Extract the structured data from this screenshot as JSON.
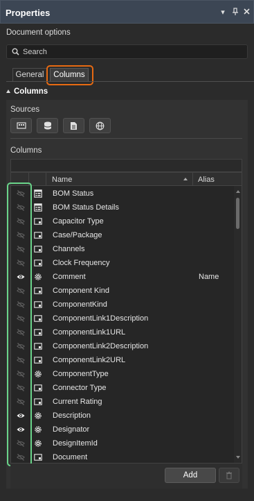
{
  "panel": {
    "title": "Properties",
    "subtitle": "Document options"
  },
  "search": {
    "placeholder": "Search"
  },
  "tabs": [
    {
      "label": "General",
      "active": false
    },
    {
      "label": "Columns",
      "active": true
    }
  ],
  "section": {
    "title": "Columns"
  },
  "sources": {
    "label": "Sources",
    "buttons": [
      "component-icon",
      "database-icon",
      "document-icon",
      "globe-icon"
    ]
  },
  "columns": {
    "label": "Columns",
    "headers": {
      "name": "Name",
      "alias": "Alias"
    },
    "rows": [
      {
        "name": "BOM Status",
        "alias": "",
        "visible": false,
        "type": "bom-icon"
      },
      {
        "name": "BOM Status Details",
        "alias": "",
        "visible": false,
        "type": "bom-icon"
      },
      {
        "name": "Capacitor Type",
        "alias": "",
        "visible": false,
        "type": "parameter-icon"
      },
      {
        "name": "Case/Package",
        "alias": "",
        "visible": false,
        "type": "parameter-icon"
      },
      {
        "name": "Channels",
        "alias": "",
        "visible": false,
        "type": "parameter-icon"
      },
      {
        "name": "Clock Frequency",
        "alias": "",
        "visible": false,
        "type": "parameter-icon"
      },
      {
        "name": "Comment",
        "alias": "Name",
        "visible": true,
        "type": "system-icon"
      },
      {
        "name": "Component Kind",
        "alias": "",
        "visible": false,
        "type": "parameter-icon"
      },
      {
        "name": "ComponentKind",
        "alias": "",
        "visible": false,
        "type": "parameter-icon"
      },
      {
        "name": "ComponentLink1Description",
        "alias": "",
        "visible": false,
        "type": "parameter-icon"
      },
      {
        "name": "ComponentLink1URL",
        "alias": "",
        "visible": false,
        "type": "parameter-icon"
      },
      {
        "name": "ComponentLink2Description",
        "alias": "",
        "visible": false,
        "type": "parameter-icon"
      },
      {
        "name": "ComponentLink2URL",
        "alias": "",
        "visible": false,
        "type": "parameter-icon"
      },
      {
        "name": "ComponentType",
        "alias": "",
        "visible": false,
        "type": "system-icon"
      },
      {
        "name": "Connector Type",
        "alias": "",
        "visible": false,
        "type": "parameter-icon"
      },
      {
        "name": "Current Rating",
        "alias": "",
        "visible": false,
        "type": "parameter-icon"
      },
      {
        "name": "Description",
        "alias": "",
        "visible": true,
        "type": "system-icon"
      },
      {
        "name": "Designator",
        "alias": "",
        "visible": true,
        "type": "system-icon"
      },
      {
        "name": "DesignItemId",
        "alias": "",
        "visible": false,
        "type": "system-icon"
      },
      {
        "name": "Document",
        "alias": "",
        "visible": false,
        "type": "parameter-icon"
      }
    ]
  },
  "footer": {
    "add_label": "Add"
  },
  "colors": {
    "accent_orange": "#e86a12",
    "highlight_green": "#6ad58a",
    "title_bar": "#3c4654"
  }
}
